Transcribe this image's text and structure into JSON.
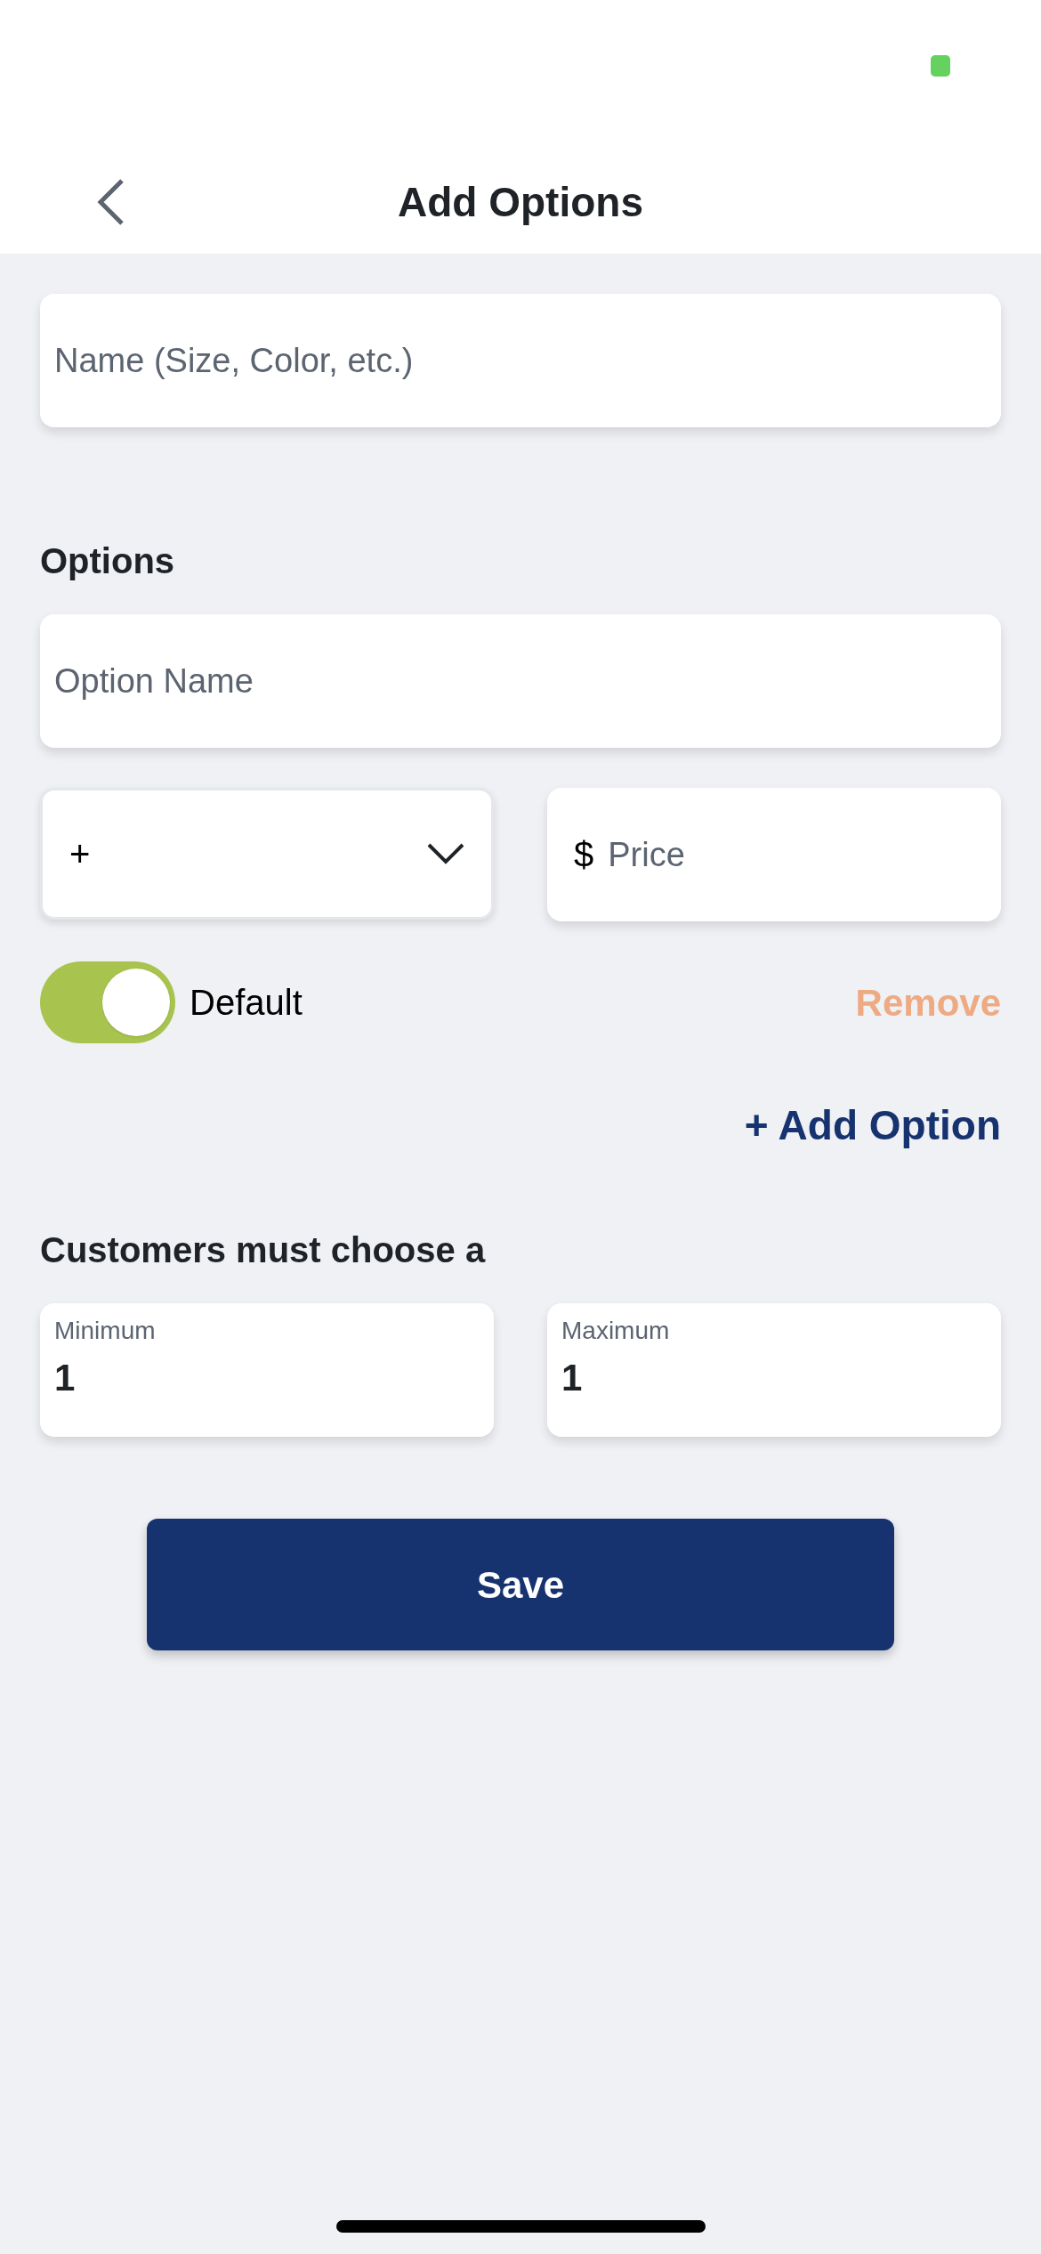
{
  "header": {
    "title": "Add Options"
  },
  "name_field": {
    "placeholder": "Name (Size, Color, etc.)"
  },
  "options_section": {
    "title": "Options",
    "options": [
      {
        "name_placeholder": "Option Name",
        "modifier": "+",
        "currency": "$",
        "price_placeholder": "Price",
        "default_label": "Default",
        "default_on": true,
        "remove_label": "Remove"
      }
    ],
    "add_option": "+ Add Option"
  },
  "choose_section": {
    "title": "Customers must choose a",
    "minimum": {
      "label": "Minimum",
      "value": "1"
    },
    "maximum": {
      "label": "Maximum",
      "value": "1"
    }
  },
  "save_button": "Save"
}
